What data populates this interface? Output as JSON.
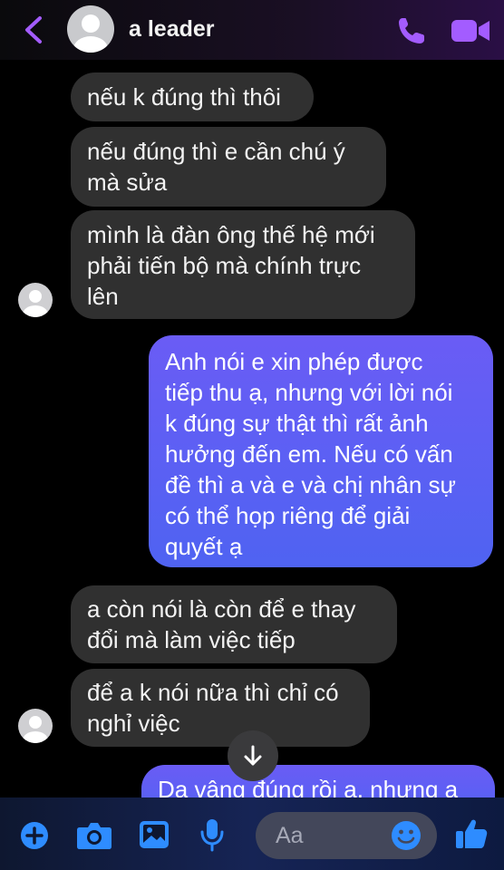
{
  "header": {
    "contact_name": "a leader",
    "icons": [
      "back-chevron-icon",
      "avatar",
      "phone-icon",
      "video-camera-icon"
    ],
    "accent_color": "#a35cff"
  },
  "messages": [
    {
      "direction": "incoming",
      "text": "nếu k đúng thì thôi"
    },
    {
      "direction": "incoming",
      "text": "nếu đúng thì e cần chú ý\nmà sửa"
    },
    {
      "direction": "incoming",
      "text": "mình là đàn ông thế hệ mới\nphải tiến bộ mà chính trực\nlên"
    },
    {
      "direction": "outgoing",
      "text": "Anh nói e xin phép được\ntiếp thu ạ, nhưng với lời nói\nk đúng sự thật thì rất ảnh\nhưởng đến em. Nếu có vấn\nđề thì a và e và chị nhân sự\ncó thể họp riêng để giải\nquyết ạ"
    },
    {
      "direction": "incoming",
      "text": "a còn nói là còn để e thay\nđổi mà làm việc tiếp"
    },
    {
      "direction": "incoming",
      "text": "để a k nói nữa thì chỉ có\nnghỉ việc"
    },
    {
      "direction": "outgoing",
      "text": "Dạ vâng đúng rồi a, nhưng a"
    }
  ],
  "composer": {
    "placeholder": "Aa",
    "icons": [
      "plus-icon",
      "camera-icon",
      "image-icon",
      "microphone-icon",
      "emoji-icon",
      "thumbs-up-icon"
    ],
    "accent_color": "#2e8cff"
  },
  "colors": {
    "incoming_bubble": "#303030",
    "outgoing_bubble": "#5b60f3",
    "background": "#000000"
  }
}
